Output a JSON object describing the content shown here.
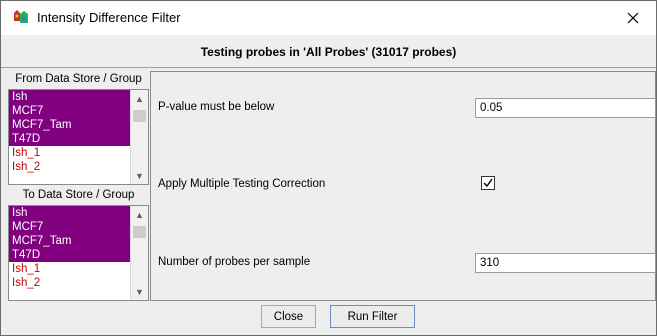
{
  "window": {
    "title": "Intensity Difference Filter",
    "close_glyph": "×"
  },
  "header": {
    "text": "Testing probes in 'All Probes' (31017 probes)"
  },
  "from_group": {
    "label": "From Data Store / Group",
    "items": [
      {
        "label": "Ish",
        "selected": true
      },
      {
        "label": "MCF7",
        "selected": true
      },
      {
        "label": "MCF7_Tam",
        "selected": true
      },
      {
        "label": "T47D",
        "selected": true
      },
      {
        "label": "Ish_1",
        "selected": false
      },
      {
        "label": "Ish_2",
        "selected": false
      }
    ]
  },
  "to_group": {
    "label": "To Data Store / Group",
    "items": [
      {
        "label": "Ish",
        "selected": true
      },
      {
        "label": "MCF7",
        "selected": true
      },
      {
        "label": "MCF7_Tam",
        "selected": true
      },
      {
        "label": "T47D",
        "selected": true
      },
      {
        "label": "Ish_1",
        "selected": false
      },
      {
        "label": "Ish_2",
        "selected": false
      }
    ]
  },
  "options": {
    "pvalue_label": "P-value must be below",
    "pvalue_value": "0.05",
    "correction_label": "Apply Multiple Testing Correction",
    "correction_checked": true,
    "probes_label": "Number of probes per sample",
    "probes_value": "310"
  },
  "buttons": {
    "close_label": "Close",
    "run_label": "Run Filter"
  },
  "colors": {
    "selected_bg": "#800080",
    "selected_text": "#ffffff",
    "unselected_text": "#cc0000"
  }
}
